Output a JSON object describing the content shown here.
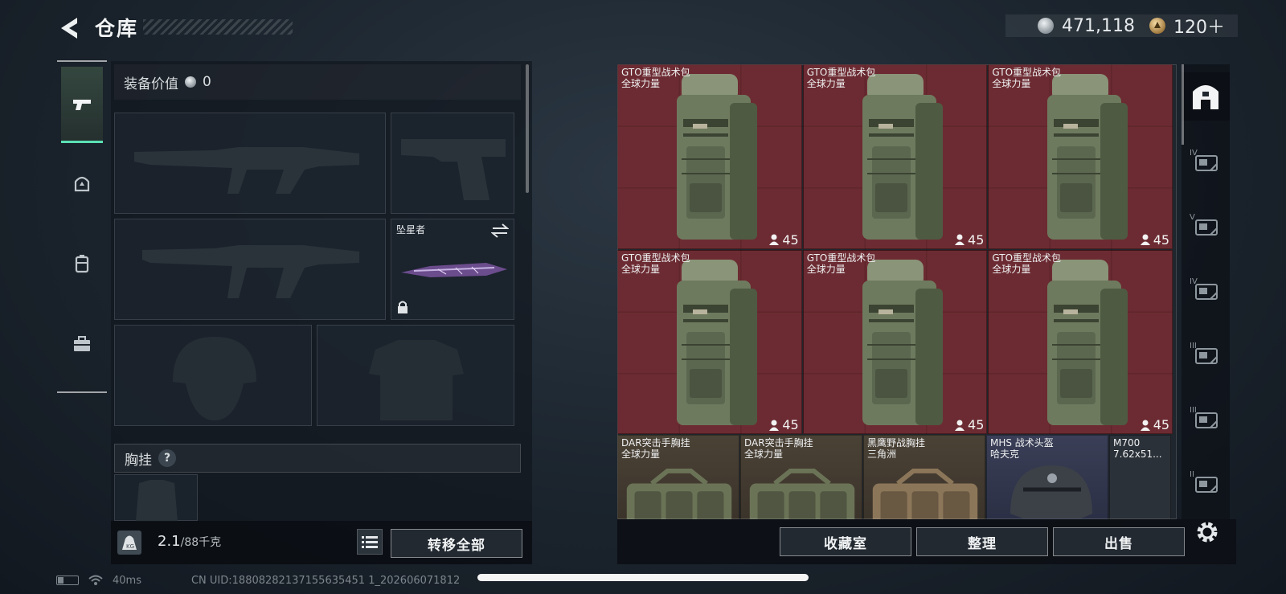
{
  "header": {
    "title": "仓库",
    "currency_silver": "471,118",
    "currency_gold": "120＋"
  },
  "left_nav": {
    "items": [
      {
        "icon": "pistol-icon",
        "active": true
      },
      {
        "icon": "helmet-icon",
        "active": false
      },
      {
        "icon": "backpack-icon",
        "active": false
      },
      {
        "icon": "toolbox-icon",
        "active": false
      }
    ]
  },
  "loadout": {
    "equip_value_label": "装备价值",
    "equip_value": "0",
    "melee_label": "坠星者",
    "chest_rig_label": "胸挂",
    "help_label": "?",
    "weight_current": "2.1",
    "weight_max": "/88千克",
    "transfer_all_label": "转移全部"
  },
  "stash": {
    "backpacks": [
      {
        "name": "GTO重型战术包",
        "maker": "全球力量",
        "count": "45"
      },
      {
        "name": "GTO重型战术包",
        "maker": "全球力量",
        "count": "45"
      },
      {
        "name": "GTO重型战术包",
        "maker": "全球力量",
        "count": "45"
      },
      {
        "name": "GTO重型战术包",
        "maker": "全球力量",
        "count": "45"
      },
      {
        "name": "GTO重型战术包",
        "maker": "全球力量",
        "count": "45"
      },
      {
        "name": "GTO重型战术包",
        "maker": "全球力量",
        "count": "45"
      }
    ],
    "row3": [
      {
        "name": "DAR突击手胸挂",
        "maker": "全球力量"
      },
      {
        "name": "DAR突击手胸挂",
        "maker": "全球力量"
      },
      {
        "name": "黑鹰野战胸挂",
        "maker": "三角洲"
      },
      {
        "name": "MHS 战术头盔",
        "maker": "哈夫克"
      },
      {
        "name": "M700",
        "maker": "7.62x51..."
      }
    ],
    "buttons": {
      "collection": "收藏室",
      "sort": "整理",
      "sell": "出售"
    }
  },
  "rail": {
    "items": [
      {
        "icon": "all-items-icon",
        "tier": ""
      },
      {
        "icon": "rig-tier-icon",
        "tier": "IV"
      },
      {
        "icon": "weapon-tier-icon",
        "tier": "V"
      },
      {
        "icon": "weapon-tier-icon",
        "tier": "IV"
      },
      {
        "icon": "weapon-tier-icon",
        "tier": "III"
      },
      {
        "icon": "weapon-tier-icon",
        "tier": "III"
      },
      {
        "icon": "medkit-tier-icon",
        "tier": "II"
      }
    ]
  },
  "status": {
    "ping": "40ms",
    "uid": "CN UID:18808282137155635451 1_202606071812"
  },
  "colors": {
    "accent": "#5ce0b5",
    "stash_red": "#6c2b32",
    "stash_brown": "#4b4236",
    "stash_purple": "#3a3f57"
  }
}
